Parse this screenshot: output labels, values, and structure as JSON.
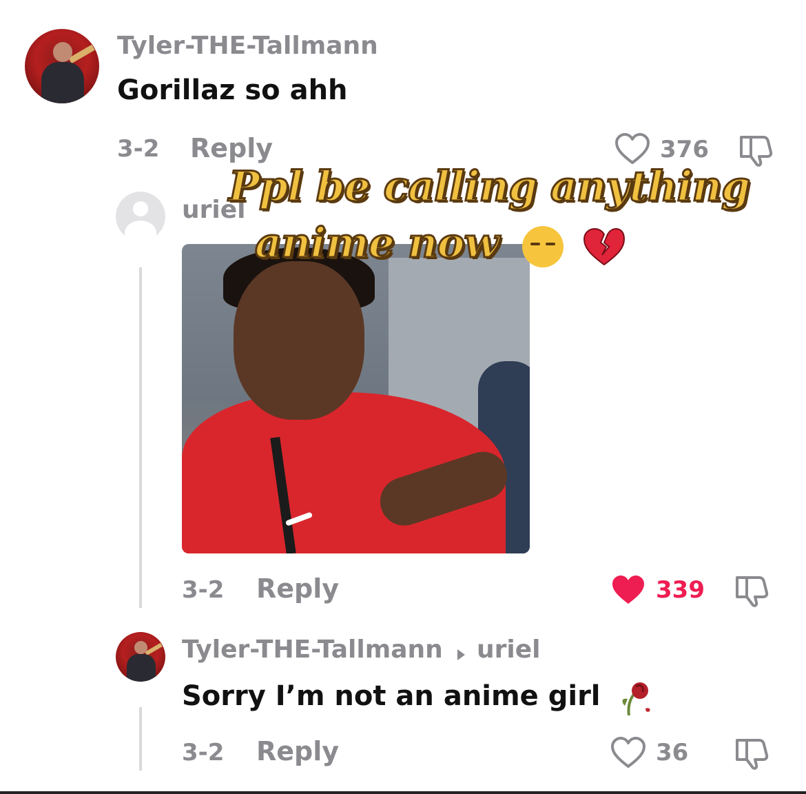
{
  "comment1": {
    "username": "Tyler-THE-Tallmann",
    "text": "Gorillaz so ahh",
    "date": "3-2",
    "reply_label": "Reply",
    "likes": "376"
  },
  "reply1": {
    "username": "uriel",
    "date": "3-2",
    "reply_label": "Reply",
    "likes": "339",
    "liked": true
  },
  "reply2": {
    "username": "Tyler-THE-Tallmann",
    "reply_to": "uriel",
    "text": "Sorry I’m not an anime girl",
    "date": "3-2",
    "reply_label": "Reply",
    "likes": "36"
  },
  "overlay": {
    "line1": "Ppl be calling anything",
    "line2": "anime now"
  },
  "colors": {
    "like_active": "#ee1d52",
    "muted_text": "#8a8a8f",
    "caption_fill": "#f0c040",
    "caption_stroke": "#5a3a10"
  },
  "icons": {
    "heart": "heart-outline-icon",
    "heart_filled": "heart-filled-icon",
    "dislike": "thumbs-down-icon",
    "wilted_rose": "wilted-rose-icon",
    "pensive": "pensive-face-icon",
    "broken_heart": "broken-heart-icon"
  }
}
